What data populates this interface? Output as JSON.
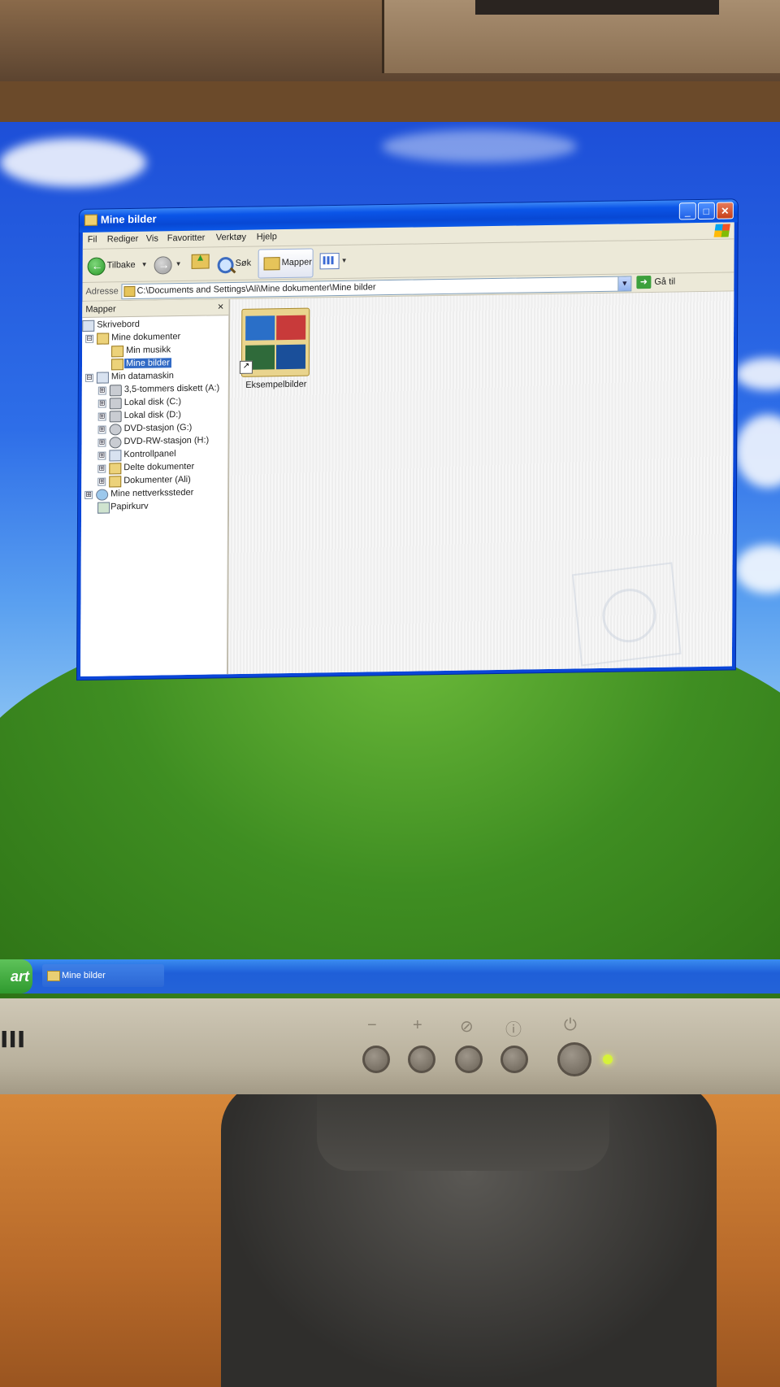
{
  "window": {
    "title": "Mine bilder"
  },
  "menu": [
    "Fil",
    "Rediger",
    "Vis",
    "Favoritter",
    "Verktøy",
    "Hjelp"
  ],
  "toolbar": {
    "back_label": "Tilbake",
    "search_label": "Søk",
    "folders_label": "Mapper"
  },
  "address": {
    "label": "Adresse",
    "value": "C:\\Documents and Settings\\Ali\\Mine dokumenter\\Mine bilder",
    "go_label": "Gå til"
  },
  "folders_pane": {
    "title": "Mapper",
    "close": "×",
    "tree": [
      {
        "label": "Skrivebord"
      },
      {
        "label": "Mine dokumenter",
        "expander": "⊟"
      },
      {
        "label": "Min musikk"
      },
      {
        "label": "Mine bilder",
        "selected": true
      },
      {
        "label": "Min datamaskin",
        "expander": "⊟"
      },
      {
        "label": "3,5-tommers diskett (A:)",
        "expander": "⊞"
      },
      {
        "label": "Lokal disk (C:)",
        "expander": "⊞"
      },
      {
        "label": "Lokal disk (D:)",
        "expander": "⊞"
      },
      {
        "label": "DVD-stasjon (G:)",
        "expander": "⊞"
      },
      {
        "label": "DVD-RW-stasjon (H:)",
        "expander": "⊞"
      },
      {
        "label": "Kontrollpanel",
        "expander": "⊞"
      },
      {
        "label": "Delte dokumenter",
        "expander": "⊞"
      },
      {
        "label": "Dokumenter (Ali)",
        "expander": "⊞"
      },
      {
        "label": "Mine nettverkssteder",
        "expander": "⊞"
      },
      {
        "label": "Papirkurv"
      }
    ]
  },
  "content": {
    "items": [
      {
        "label": "Eksempelbilder",
        "thumb_colors": [
          "#2a6fc8",
          "#c83a3a",
          "#2f6a3a",
          "#1a4f9a"
        ]
      }
    ]
  },
  "taskbar": {
    "start_label": "art",
    "items": [
      {
        "label": "Mine bilder"
      }
    ]
  },
  "monitor": {
    "brand": "III",
    "buttons": [
      "−",
      "+",
      "⊘",
      "ⓘ",
      "⏻"
    ]
  }
}
